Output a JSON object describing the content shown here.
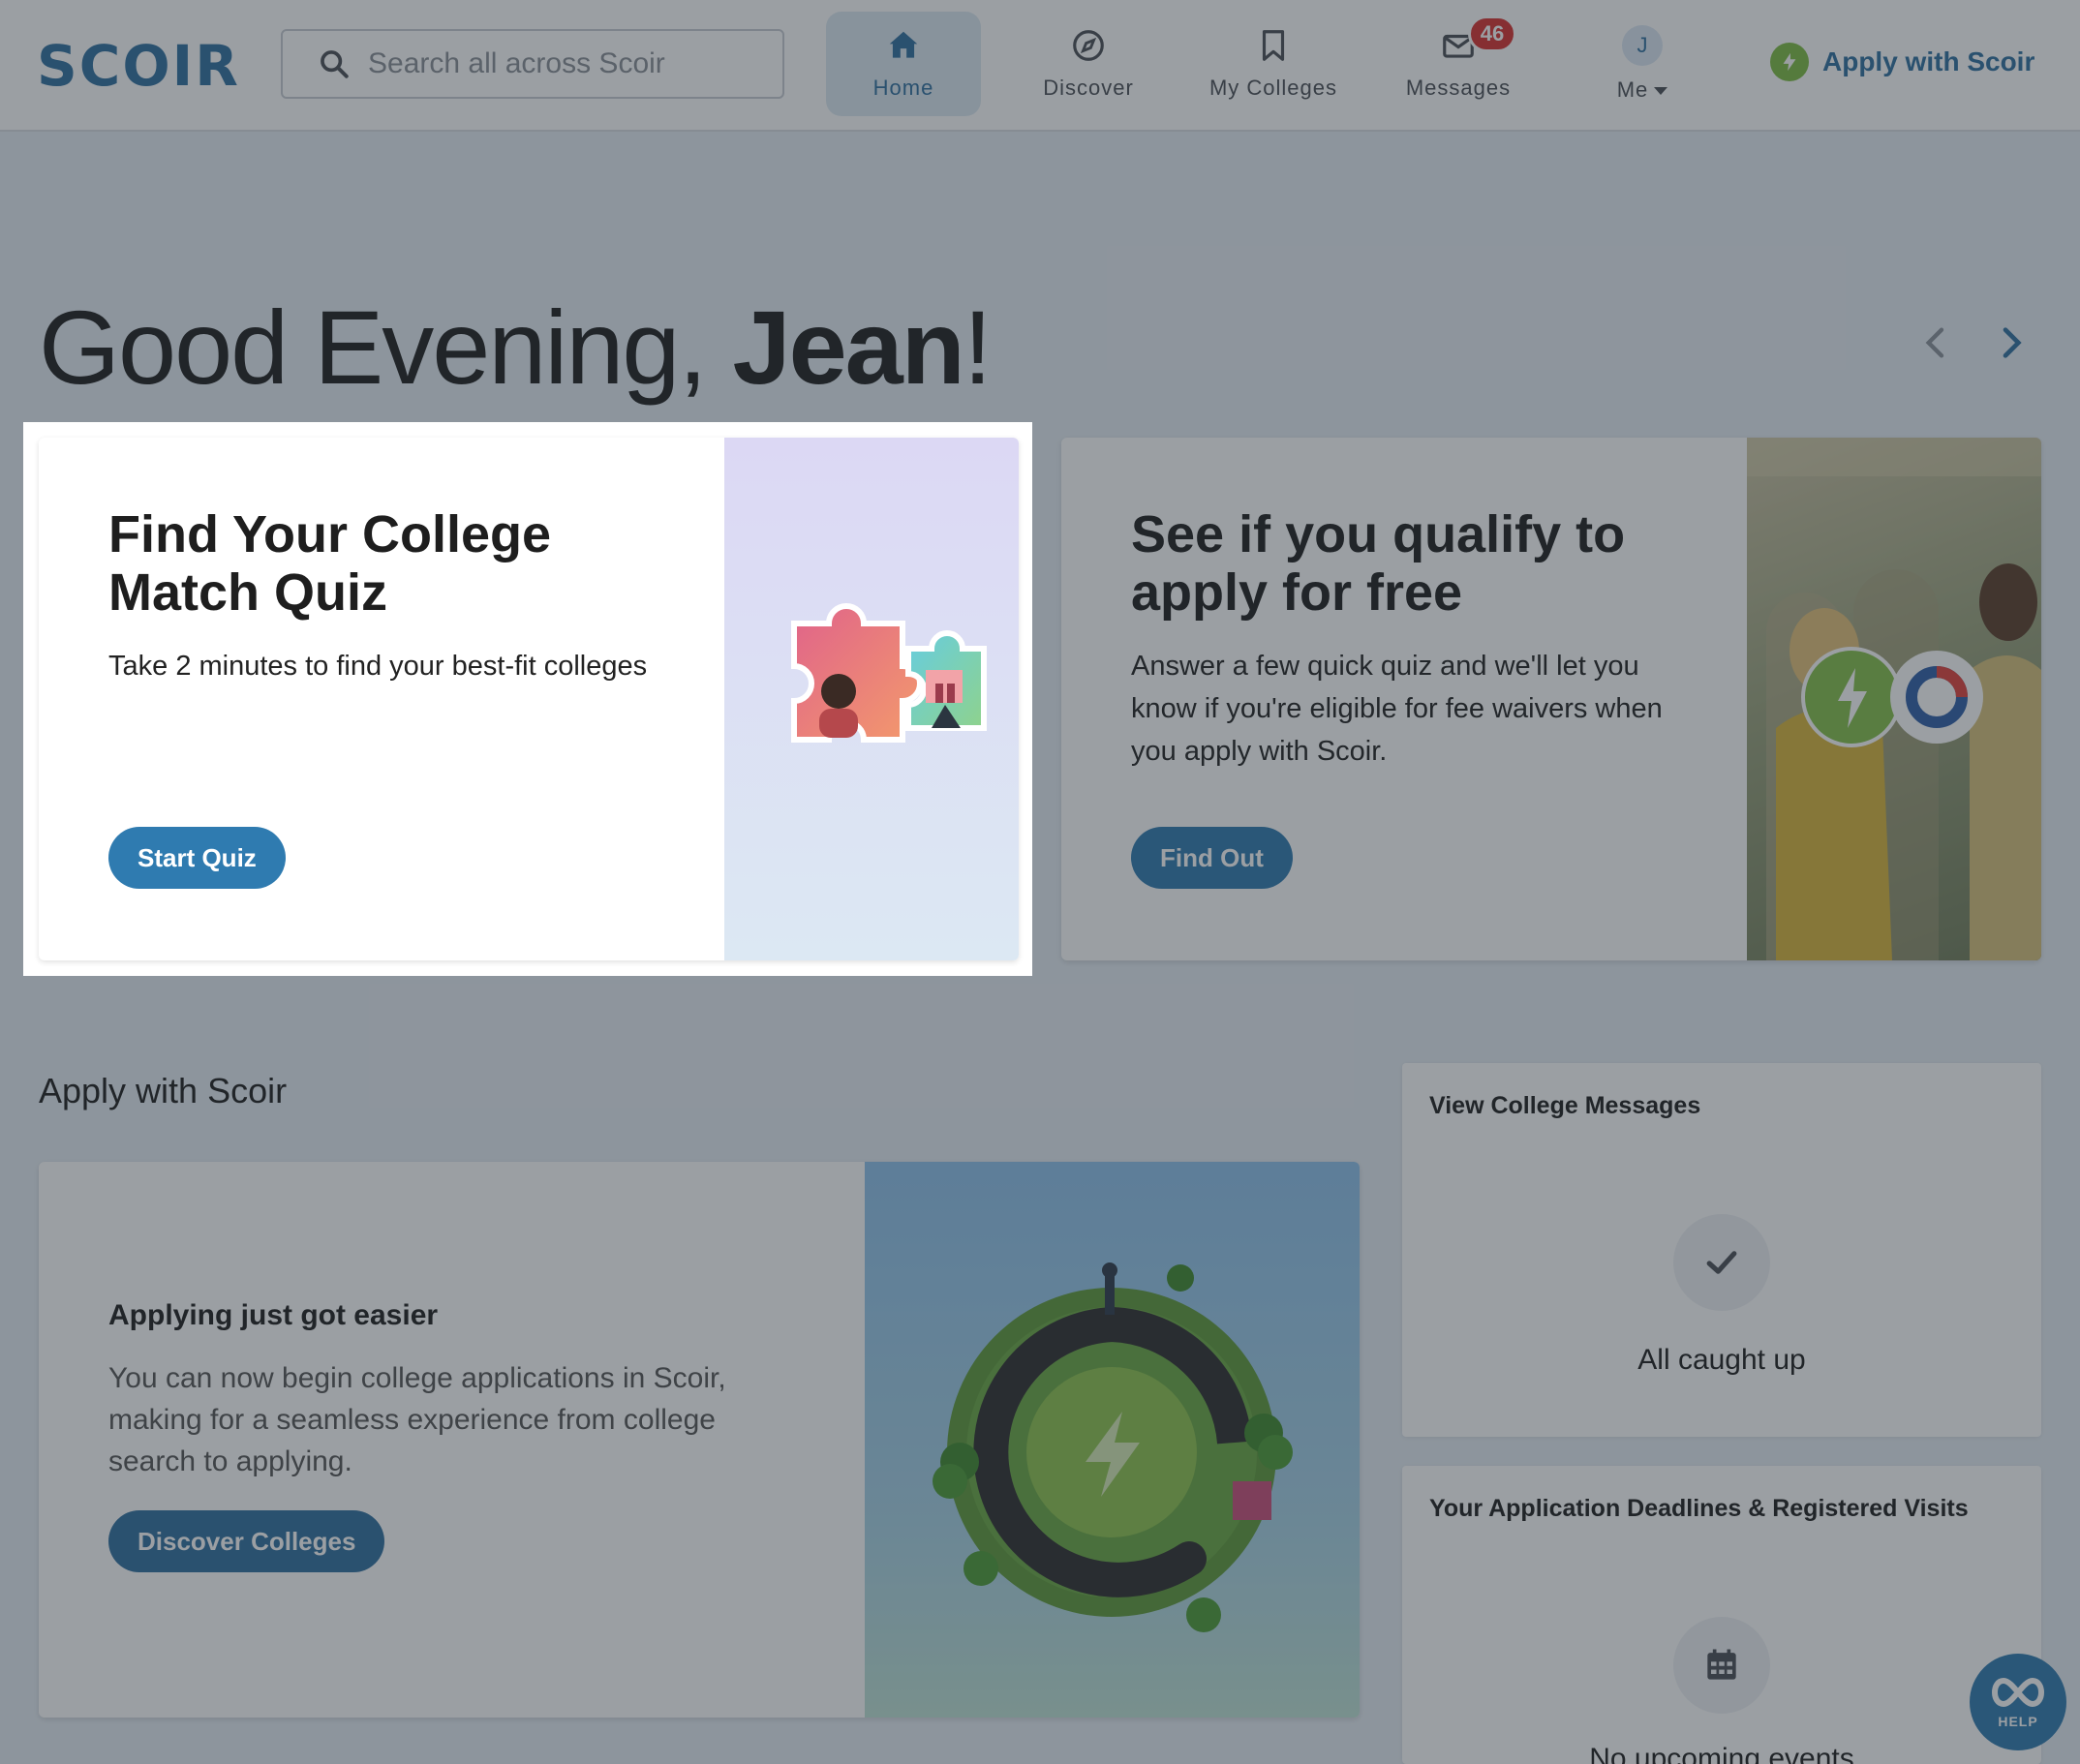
{
  "brand": {
    "logo": "SCOIR",
    "accent": "#2f6f9f",
    "button": "#2f7bb0",
    "green": "#7fbd44"
  },
  "search": {
    "placeholder": "Search all across Scoir"
  },
  "nav": {
    "home": "Home",
    "discover": "Discover",
    "colleges": "My Colleges",
    "messages": "Messages",
    "messages_count": "46",
    "me": "Me",
    "avatar_initial": "J"
  },
  "apply_link": "Apply with Scoir",
  "greeting": {
    "prefix": "Good Evening, ",
    "name": "Jean",
    "suffix": "!"
  },
  "quiz_card": {
    "title": "Find Your College Match Quiz",
    "description": "Take 2 minutes to find your best-fit colleges",
    "button": "Start Quiz",
    "icon": "puzzle-pieces-illustration"
  },
  "qualify_card": {
    "title": "See if you qualify to apply for free",
    "description": "Answer a few quick quiz and we'll let you know if you're eligible for fee waivers when you apply with Scoir.",
    "button": "Find Out",
    "icon": "students-photo"
  },
  "apply_section": {
    "title": "Apply with Scoir",
    "heading": "Applying just got easier",
    "body": "You can now begin college applications in Scoir, making for a seamless experience from college search to applying.",
    "button": "Discover Colleges",
    "icon": "planet-path-illustration"
  },
  "messages_panel": {
    "title": "View College Messages",
    "status": "All caught up",
    "icon": "check-icon"
  },
  "deadlines_panel": {
    "title": "Your Application Deadlines & Registered Visits",
    "status": "No upcoming events",
    "icon": "calendar-icon"
  },
  "help": {
    "label": "HELP"
  }
}
